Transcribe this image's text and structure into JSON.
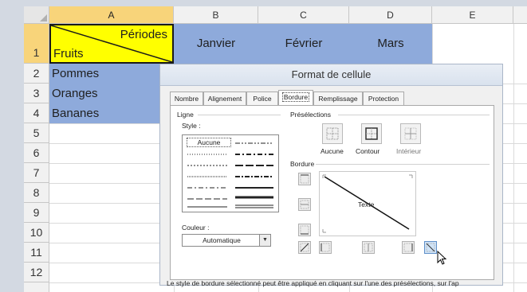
{
  "spreadsheet": {
    "columns": [
      "A",
      "B",
      "C",
      "D",
      "E"
    ],
    "rows": [
      "1",
      "2",
      "3",
      "4",
      "5",
      "6",
      "7",
      "8",
      "9",
      "10",
      "11",
      "12"
    ],
    "a1_top_right": "Périodes",
    "a1_bottom_left": "Fruits",
    "months": [
      "Janvier",
      "Février",
      "Mars"
    ],
    "fruits": [
      "Pommes",
      "Oranges",
      "Bananes"
    ],
    "colors": {
      "header_fill": "#8eaadb",
      "a1_fill": "#ffff00",
      "selected_header": "#f8d47a"
    }
  },
  "dialog": {
    "title": "Format de cellule",
    "tabs": [
      "Nombre",
      "Alignement",
      "Police",
      "Bordure",
      "Remplissage",
      "Protection"
    ],
    "active_tab": "Bordure",
    "line_group": "Ligne",
    "style_label": "Style :",
    "style_none": "Aucune",
    "color_label": "Couleur :",
    "color_value": "Automatique",
    "presets_group": "Présélections",
    "presets": [
      "Aucune",
      "Contour",
      "Intérieur"
    ],
    "border_group": "Bordure",
    "preview_text": "Texte",
    "footer": "Le style de bordure sélectionné peut être appliqué en cliquant sur l'une des présélections, sur l'ap"
  }
}
